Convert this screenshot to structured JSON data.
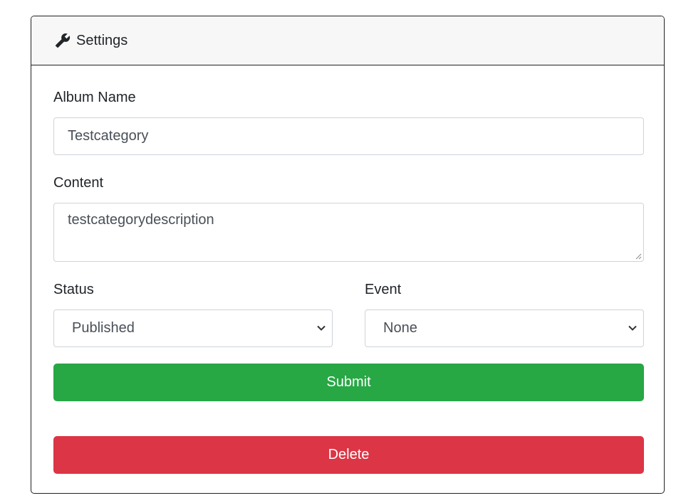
{
  "header": {
    "title": "Settings",
    "icon": "wrench-icon"
  },
  "form": {
    "album_name": {
      "label": "Album Name",
      "value": "Testcategory"
    },
    "content": {
      "label": "Content",
      "value": "testcategorydescription"
    },
    "status": {
      "label": "Status",
      "selected": "Published"
    },
    "event": {
      "label": "Event",
      "selected": "None"
    },
    "submit_label": "Submit",
    "delete_label": "Delete"
  },
  "colors": {
    "submit": "#28a745",
    "delete": "#dc3545",
    "header_bg": "#f7f7f7"
  }
}
